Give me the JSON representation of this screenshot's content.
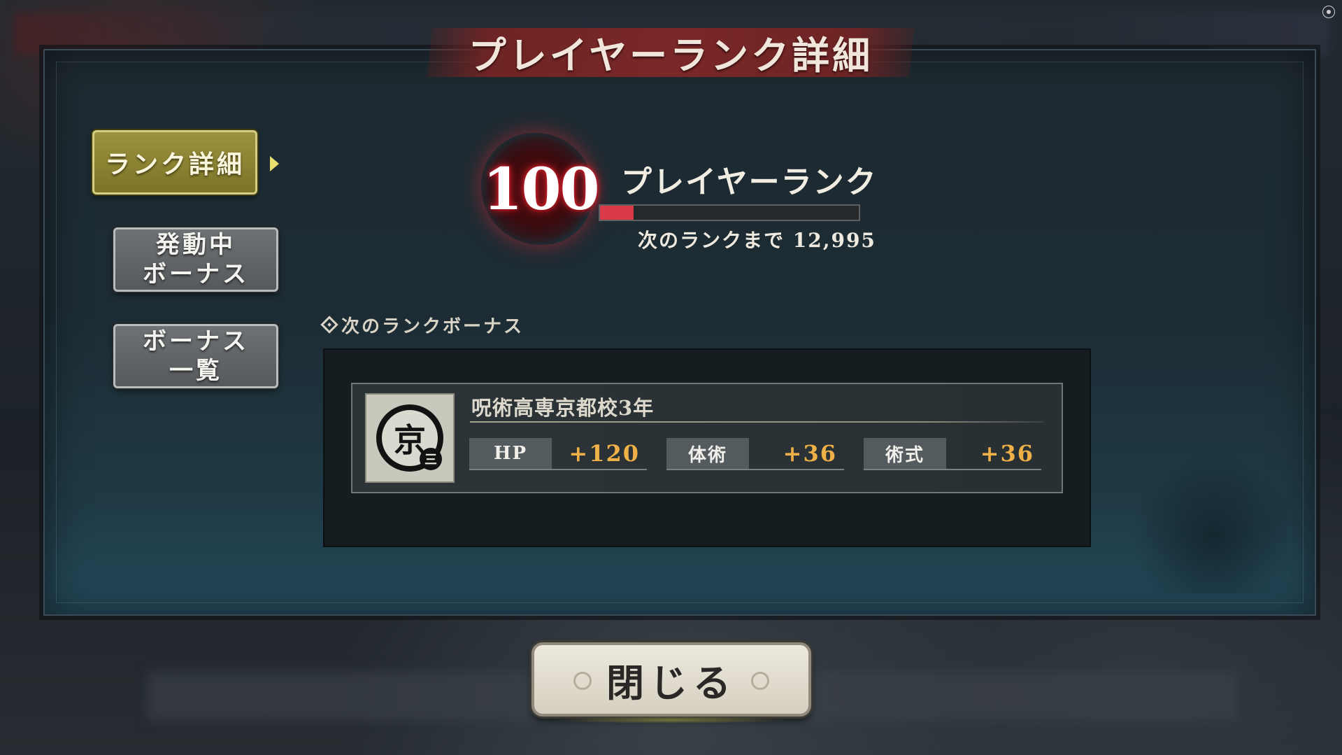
{
  "title": "プレイヤーランク詳細",
  "sidebar": {
    "items": [
      {
        "label": "ランク詳細",
        "active": true
      },
      {
        "label_line1": "発動中",
        "label_line2": "ボーナス",
        "active": false
      },
      {
        "label_line1": "ボーナス",
        "label_line2": "一覧",
        "active": false
      }
    ]
  },
  "rank": {
    "value": "100",
    "label": "プレイヤーランク",
    "progress_fraction": 0.13,
    "next_rank_text": "次のランクまで 12,995"
  },
  "next_bonus": {
    "heading": "次のランクボーナス",
    "name": "呪術高専京都校3年",
    "emblem_icon": "kyoto-school-emblem-icon",
    "emblem_char": "京",
    "emblem_sub_char": "三",
    "stats": [
      {
        "label": "HP",
        "value": "+120"
      },
      {
        "label": "体術",
        "value": "+36"
      },
      {
        "label": "術式",
        "value": "+36"
      }
    ]
  },
  "close_label": "閉じる",
  "colors": {
    "accent_gold": "#9c9340",
    "progress_red": "#d83a48",
    "stat_value": "#efb147",
    "title_banner": "#7a2828"
  }
}
